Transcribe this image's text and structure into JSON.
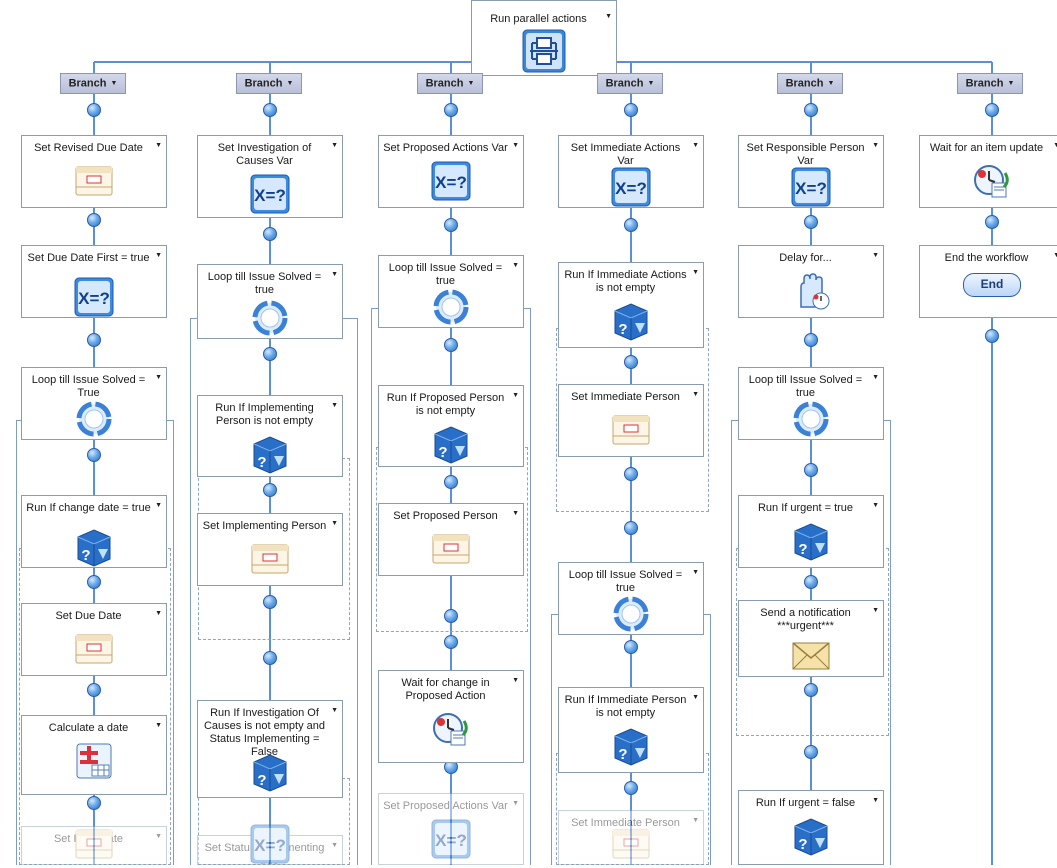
{
  "root": {
    "label": "Run parallel actions",
    "icon": "parallel-actions-icon"
  },
  "branch_label": "Branch",
  "columns": [
    {
      "nodes": [
        {
          "label": "Set Revised Due Date",
          "icon": "form-icon"
        },
        {
          "label": "Set Due Date First = true",
          "icon": "variable-icon"
        },
        {
          "label": "Loop till Issue Solved = True",
          "icon": "loop-icon"
        },
        {
          "label": "Run If change date = true",
          "icon": "condition-icon"
        },
        {
          "label": "Set Due Date",
          "icon": "form-icon"
        },
        {
          "label": "Calculate a date",
          "icon": "calculator-icon"
        },
        {
          "label": "Set Rem Date",
          "icon": "form-icon"
        }
      ]
    },
    {
      "nodes": [
        {
          "label": "Set Investigation of Causes Var",
          "icon": "variable-icon"
        },
        {
          "label": "Loop till Issue Solved = true",
          "icon": "loop-icon"
        },
        {
          "label": "Run If Implementing Person is not empty",
          "icon": "condition-icon"
        },
        {
          "label": "Set Implementing Person",
          "icon": "form-icon"
        },
        {
          "label": "Run If Investigation Of Causes is not empty and Status Implementing = False",
          "icon": "condition-icon"
        },
        {
          "label": "Set Status Implementing = true",
          "icon": "variable-icon"
        }
      ]
    },
    {
      "nodes": [
        {
          "label": "Set Proposed Actions Var",
          "icon": "variable-icon"
        },
        {
          "label": "Loop till Issue Solved = true",
          "icon": "loop-icon"
        },
        {
          "label": "Run If Proposed Person is not empty",
          "icon": "condition-icon"
        },
        {
          "label": "Set Proposed Person",
          "icon": "form-icon"
        },
        {
          "label": "Wait for change in Proposed Action",
          "icon": "wait-icon"
        },
        {
          "label": "Set Proposed Actions Var",
          "icon": "variable-icon"
        }
      ]
    },
    {
      "nodes": [
        {
          "label": "Set Immediate Actions Var",
          "icon": "variable-icon"
        },
        {
          "label": "Run If Immediate Actions is not empty",
          "icon": "condition-icon"
        },
        {
          "label": "Set Immediate Person",
          "icon": "form-icon"
        },
        {
          "label": "Loop till Issue Solved = true",
          "icon": "loop-icon"
        },
        {
          "label": "Run If Immediate Person is not empty",
          "icon": "condition-icon"
        },
        {
          "label": "Set Immediate Person",
          "icon": "form-icon"
        }
      ]
    },
    {
      "nodes": [
        {
          "label": "Set Responsible Person Var",
          "icon": "variable-icon"
        },
        {
          "label": "Delay for...",
          "icon": "delay-icon"
        },
        {
          "label": "Loop till Issue Solved = true",
          "icon": "loop-icon"
        },
        {
          "label": "Run If urgent = true",
          "icon": "condition-icon"
        },
        {
          "label": "Send a notification ***urgent***",
          "icon": "mail-icon"
        },
        {
          "label": "Run If urgent = false",
          "icon": "condition-icon"
        }
      ]
    },
    {
      "nodes": [
        {
          "label": "Wait for an item update",
          "icon": "wait-icon"
        },
        {
          "label": "End the workflow",
          "icon": "end-icon",
          "button": "End"
        }
      ]
    }
  ],
  "colors": {
    "connector": "#5b8fd9",
    "border": "#8a9cb0",
    "branch_bg": "#c4cadf",
    "dot": "#3a7fd6"
  }
}
